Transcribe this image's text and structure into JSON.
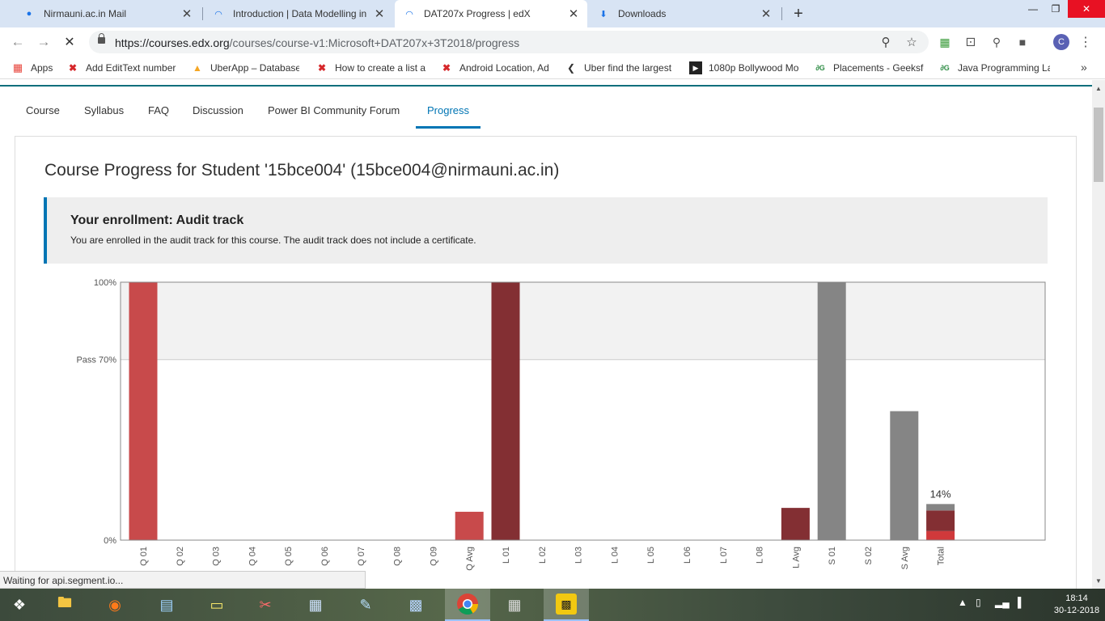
{
  "browser": {
    "tabs": [
      {
        "title": "Nirmauni.ac.in Mail",
        "icon": "mail-icon",
        "active": false
      },
      {
        "title": "Introduction | Data Modelling in",
        "icon": "edx-loading-icon",
        "active": false
      },
      {
        "title": "DAT207x Progress | edX",
        "icon": "edx-loading-icon",
        "active": true
      },
      {
        "title": "Downloads",
        "icon": "download-icon",
        "active": false
      }
    ],
    "url_host": "https://courses.edx.org",
    "url_path": "/courses/course-v1:Microsoft+DAT207x+3T2018/progress",
    "profile_initial": "C",
    "bookmarks": [
      {
        "label": "Apps",
        "icon": "apps-grid-icon"
      },
      {
        "label": "Add EditText number",
        "icon": "red-x-icon"
      },
      {
        "label": "UberApp – Database",
        "icon": "firebase-icon"
      },
      {
        "label": "How to create a list a",
        "icon": "red-x-icon"
      },
      {
        "label": "Android Location, Ad",
        "icon": "red-x-icon"
      },
      {
        "label": "Uber find the largest",
        "icon": "code-icon"
      },
      {
        "label": "1080p Bollywood Mo",
        "icon": "play-icon"
      },
      {
        "label": "Placements - Geeksfo",
        "icon": "gfg-icon"
      },
      {
        "label": "Java Programming La",
        "icon": "gfg-icon"
      }
    ]
  },
  "course_nav": [
    {
      "label": "Course",
      "active": false
    },
    {
      "label": "Syllabus",
      "active": false
    },
    {
      "label": "FAQ",
      "active": false
    },
    {
      "label": "Discussion",
      "active": false
    },
    {
      "label": "Power BI Community Forum",
      "active": false
    },
    {
      "label": "Progress",
      "active": true
    }
  ],
  "page": {
    "title": "Course Progress for Student '15bce004' (15bce004@nirmauni.ac.in)",
    "enrollment_heading": "Your enrollment: Audit track",
    "enrollment_text": "You are enrolled in the audit track for this course. The audit track does not include a certificate."
  },
  "chart_data": {
    "type": "bar",
    "ylim": [
      0,
      100
    ],
    "y_tick_labels": [
      {
        "value": 100,
        "label": "100%"
      },
      {
        "value": 70,
        "label": "Pass 70%"
      },
      {
        "value": 0,
        "label": "0%"
      }
    ],
    "pass_threshold": 70,
    "categories": [
      "Q 01",
      "Q 02",
      "Q 03",
      "Q 04",
      "Q 05",
      "Q 06",
      "Q 07",
      "Q 08",
      "Q 09",
      "Q Avg",
      "L 01",
      "L 02",
      "L 03",
      "L 04",
      "L 05",
      "L 06",
      "L 07",
      "L 08",
      "L Avg",
      "S 01",
      "S 02",
      "S Avg",
      "Total"
    ],
    "values": [
      100,
      0,
      0,
      0,
      0,
      0,
      0,
      0,
      0,
      11,
      100,
      0,
      0,
      0,
      0,
      0,
      0,
      0,
      12.5,
      100,
      0,
      50,
      14
    ],
    "bar_colors": [
      "#c84a4b",
      "#c84a4b",
      "#c84a4b",
      "#c84a4b",
      "#c84a4b",
      "#c84a4b",
      "#c84a4b",
      "#c84a4b",
      "#c84a4b",
      "#c84a4b",
      "#832f33",
      "#832f33",
      "#832f33",
      "#832f33",
      "#832f33",
      "#832f33",
      "#832f33",
      "#832f33",
      "#832f33",
      "#858585",
      "#858585",
      "#858585",
      "stacked"
    ],
    "total_stack": [
      {
        "value": 3.5,
        "color": "#d0393b"
      },
      {
        "value": 8,
        "color": "#832f33"
      },
      {
        "value": 2.5,
        "color": "#858585"
      }
    ],
    "total_label": "14%"
  },
  "status_text": "Waiting for api.segment.io...",
  "taskbar": {
    "apps": [
      "windows-start-icon",
      "file-explorer-icon",
      "firefox-icon",
      "performance-monitor-icon",
      "sticky-notes-icon",
      "snipping-tool-icon",
      "calculator-icon",
      "notepad-icon",
      "control-panel-icon",
      "chrome-icon",
      "firewall-icon",
      "power-bi-icon"
    ],
    "time": "18:14",
    "date": "30-12-2018"
  }
}
